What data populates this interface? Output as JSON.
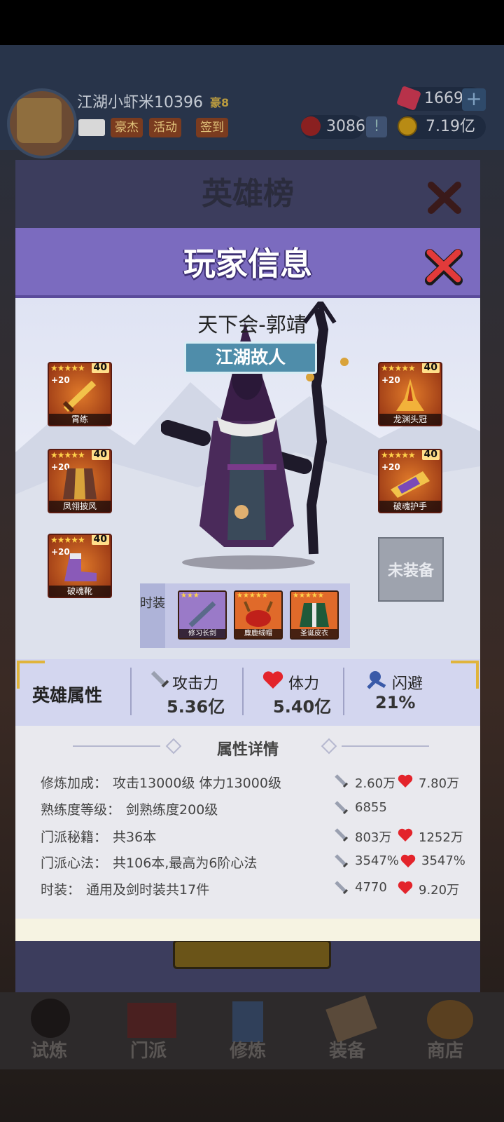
{
  "topbar": {
    "player_name": "江湖小虾米10396",
    "vip_label": "豪8",
    "tags": [
      "豪杰",
      "活动",
      "签到"
    ],
    "gems": "1669",
    "tokens": "3086",
    "gold": "7.19亿"
  },
  "back_panel": {
    "title": "英雄榜"
  },
  "nav": {
    "items": [
      "试炼",
      "门派",
      "修炼",
      "装备",
      "商店"
    ]
  },
  "popup": {
    "title": "玩家信息",
    "hero_name": "天下会-郭靖",
    "hero_title": "江湖故人",
    "equipment": [
      {
        "name": "霄练",
        "level": "40",
        "plus": "+20",
        "stars": "★★★★★"
      },
      {
        "name": "凤翎披风",
        "level": "40",
        "plus": "+20",
        "stars": "★★★★★"
      },
      {
        "name": "破魂靴",
        "level": "40",
        "plus": "+20",
        "stars": "★★★★★"
      },
      {
        "name": "龙渊头冠",
        "level": "40",
        "plus": "+20",
        "stars": "★★★★★"
      },
      {
        "name": "破魂护手",
        "level": "40",
        "plus": "+20",
        "stars": "★★★★★"
      }
    ],
    "empty_slot": "未装备",
    "fashion_label": "时装",
    "fashion": [
      {
        "name": "修习长剑",
        "stars": "★★★"
      },
      {
        "name": "麋鹿绒帽",
        "stars": "★★★★★"
      },
      {
        "name": "圣诞皮衣",
        "stars": "★★★★★"
      }
    ],
    "stats": {
      "title": "英雄属性",
      "attack_label": "攻击力",
      "attack_value": "5.36亿",
      "hp_label": "体力",
      "hp_value": "5.40亿",
      "dodge_label": "闪避",
      "dodge_value": "21%"
    },
    "details": {
      "title": "属性详情",
      "rows": [
        {
          "label": "修炼加成：",
          "text": "攻击13000级 体力13000级",
          "atk": "2.60万",
          "hp": "7.80万"
        },
        {
          "label": "熟练度等级：",
          "text": "剑熟练度200级",
          "atk": "6855",
          "hp": ""
        },
        {
          "label": "门派秘籍：",
          "text": "共36本",
          "atk": "803万",
          "hp": "1252万"
        },
        {
          "label": "门派心法：",
          "text": "共106本,最高为6阶心法",
          "atk": "3547%",
          "hp": "3547%"
        },
        {
          "label": "时装：",
          "text": "通用及剑时装共17件",
          "atk": "4770",
          "hp": "9.20万"
        }
      ]
    }
  }
}
